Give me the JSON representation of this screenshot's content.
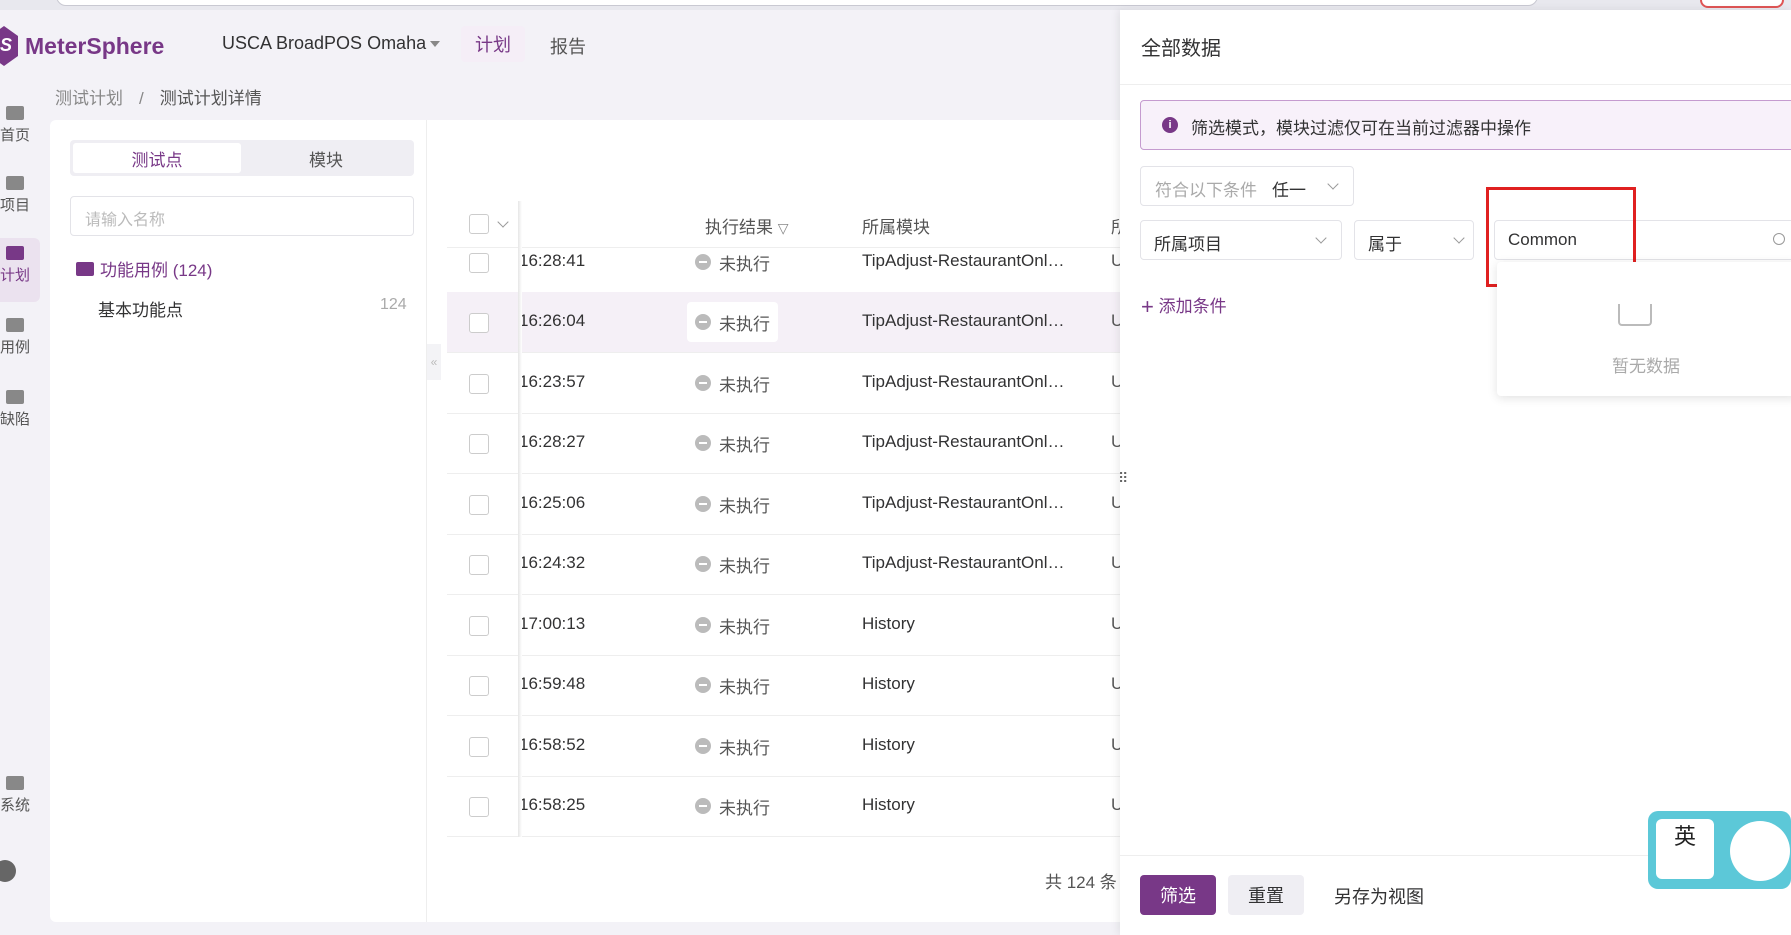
{
  "header": {
    "logo_text": "MeterSphere",
    "logo_glyph": "S",
    "project": "USCA BroadPOS Omaha",
    "tabs": [
      "计划",
      "报告"
    ]
  },
  "nav": {
    "items": [
      "首页",
      "项目",
      "计划",
      "用例",
      "缺陷",
      "系统"
    ]
  },
  "breadcrumb": {
    "first": "测试计划",
    "sep": "/",
    "current": "测试计划详情"
  },
  "left_panel": {
    "seg_active": "测试点",
    "seg_inactive": "模块",
    "search_placeholder": "请输入名称",
    "folder_label": "功能用例 (124)",
    "sub_label": "基本功能点",
    "sub_count": "124",
    "collapse_glyph": "«"
  },
  "table": {
    "headers": {
      "result": "执行结果",
      "module": "所属模块",
      "cut": "所"
    },
    "rows": [
      {
        "time": "16:28:41",
        "result": "未执行",
        "module": "TipAdjust-RestaurantOnl…",
        "u": "U"
      },
      {
        "time": "16:26:04",
        "result": "未执行",
        "module": "TipAdjust-RestaurantOnl…",
        "u": "U"
      },
      {
        "time": "16:23:57",
        "result": "未执行",
        "module": "TipAdjust-RestaurantOnl…",
        "u": "U"
      },
      {
        "time": "16:28:27",
        "result": "未执行",
        "module": "TipAdjust-RestaurantOnl…",
        "u": "U"
      },
      {
        "time": "16:25:06",
        "result": "未执行",
        "module": "TipAdjust-RestaurantOnl…",
        "u": "U"
      },
      {
        "time": "16:24:32",
        "result": "未执行",
        "module": "TipAdjust-RestaurantOnl…",
        "u": "U"
      },
      {
        "time": "17:00:13",
        "result": "未执行",
        "module": "History",
        "u": "U"
      },
      {
        "time": "16:59:48",
        "result": "未执行",
        "module": "History",
        "u": "U"
      },
      {
        "time": "16:58:52",
        "result": "未执行",
        "module": "History",
        "u": "U"
      },
      {
        "time": "16:58:25",
        "result": "未执行",
        "module": "History",
        "u": "U"
      }
    ],
    "pager": "共 124 条"
  },
  "drawer": {
    "title": "全部数据",
    "alert": "筛选模式，模块过滤仅可在当前过滤器中操作",
    "match_label": "符合以下条件",
    "match_value": "任一",
    "field": "所属项目",
    "operator": "属于",
    "value": "Common",
    "add_condition": "添加条件",
    "empty_text": "暂无数据",
    "btn_filter": "筛选",
    "btn_reset": "重置",
    "btn_save_view": "另存为视图",
    "resizer_glyph": "⠿"
  },
  "ime": {
    "label": "英"
  },
  "colors": {
    "brand": "#783887",
    "highlight": "#e02020"
  }
}
